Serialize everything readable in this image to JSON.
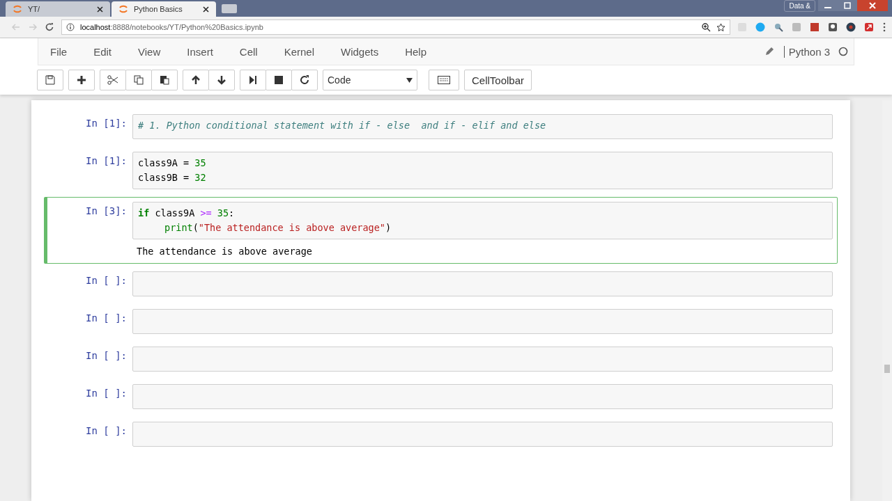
{
  "browser": {
    "tabs": [
      {
        "title": "YT/",
        "selected": false
      },
      {
        "title": "Python Basics",
        "selected": true
      }
    ],
    "url_host": "localhost",
    "url_rest": ":8888/notebooks/YT/Python%20Basics.ipynb",
    "profile_label": "Data &"
  },
  "menu": [
    "File",
    "Edit",
    "View",
    "Insert",
    "Cell",
    "Kernel",
    "Widgets",
    "Help"
  ],
  "kernel": "Python 3",
  "toolbar": {
    "cell_type": "Code",
    "celltoolbar": "CellToolbar"
  },
  "cells": [
    {
      "prompt": "In [1]:",
      "selected": false,
      "lines": [
        {
          "indent": false,
          "tokens": [
            {
              "kind": "comment",
              "text": "# 1. Python conditional statement with if - else  and if - elif and else"
            }
          ]
        }
      ]
    },
    {
      "prompt": "In [1]:",
      "selected": false,
      "lines": [
        {
          "indent": false,
          "tokens": [
            {
              "kind": "name",
              "text": "class9A = "
            },
            {
              "kind": "num",
              "text": "35"
            }
          ]
        },
        {
          "indent": false,
          "tokens": [
            {
              "kind": "name",
              "text": "class9B = "
            },
            {
              "kind": "num",
              "text": "32"
            }
          ]
        }
      ]
    },
    {
      "prompt": "In [3]:",
      "selected": true,
      "lines": [
        {
          "indent": false,
          "tokens": [
            {
              "kind": "kw",
              "text": "if"
            },
            {
              "kind": "name",
              "text": " class9A "
            },
            {
              "kind": "op",
              "text": ">="
            },
            {
              "kind": "num",
              "text": " 35"
            },
            {
              "kind": "name",
              "text": ":"
            }
          ]
        },
        {
          "indent": true,
          "tokens": [
            {
              "kind": "builtin",
              "text": "print"
            },
            {
              "kind": "name",
              "text": "("
            },
            {
              "kind": "str",
              "text": "\"The attendance is above average\""
            },
            {
              "kind": "name",
              "text": ")"
            }
          ]
        }
      ],
      "output": "The attendance is above average"
    },
    {
      "prompt": "In [ ]:",
      "selected": false
    },
    {
      "prompt": "In [ ]:",
      "selected": false
    },
    {
      "prompt": "In [ ]:",
      "selected": false
    },
    {
      "prompt": "In [ ]:",
      "selected": false
    },
    {
      "prompt": "In [ ]:",
      "selected": false
    }
  ]
}
